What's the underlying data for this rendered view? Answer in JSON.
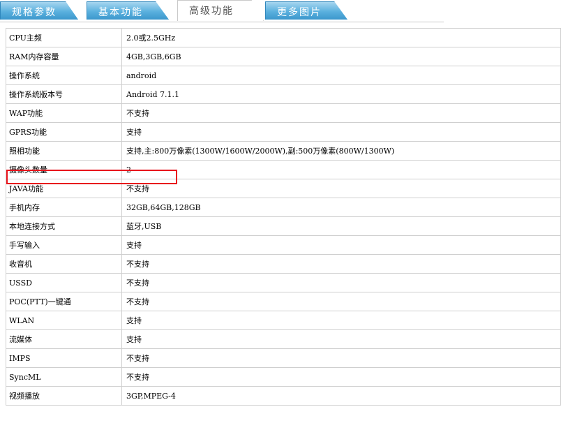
{
  "tabs": [
    {
      "label": "规格参数",
      "active": false
    },
    {
      "label": "基本功能",
      "active": false
    },
    {
      "label": "高级功能",
      "active": true
    },
    {
      "label": "更多图片",
      "active": false
    }
  ],
  "rows": [
    {
      "key": "CPU主频",
      "value": "2.0或2.5GHz"
    },
    {
      "key": "RAM内存容量",
      "value": "4GB,3GB,6GB"
    },
    {
      "key": "操作系统",
      "value": "android"
    },
    {
      "key": "操作系统版本号",
      "value": "Android 7.1.1"
    },
    {
      "key": "WAP功能",
      "value": "不支持"
    },
    {
      "key": "GPRS功能",
      "value": "支持"
    },
    {
      "key": "照相功能",
      "value": "支持,主:800万像素(1300W/1600W/2000W),副:500万像素(800W/1300W)"
    },
    {
      "key": "摄像头数量",
      "value": "2"
    },
    {
      "key": "JAVA功能",
      "value": "不支持"
    },
    {
      "key": "手机内存",
      "value": "32GB,64GB,128GB"
    },
    {
      "key": "本地连接方式",
      "value": "蓝牙,USB"
    },
    {
      "key": "手写输入",
      "value": "支持"
    },
    {
      "key": "收音机",
      "value": "不支持"
    },
    {
      "key": "USSD",
      "value": "不支持"
    },
    {
      "key": "POC(PTT)一键通",
      "value": "不支持"
    },
    {
      "key": "WLAN",
      "value": "支持"
    },
    {
      "key": "流媒体",
      "value": "支持"
    },
    {
      "key": "IMPS",
      "value": "不支持"
    },
    {
      "key": "SyncML",
      "value": "不支持"
    },
    {
      "key": "视频播放",
      "value": "3GP,MPEG-4"
    }
  ],
  "colors": {
    "tab_blue": "#5ab0de",
    "highlight_red": "#e8141c",
    "grid": "#cfcfcf"
  }
}
